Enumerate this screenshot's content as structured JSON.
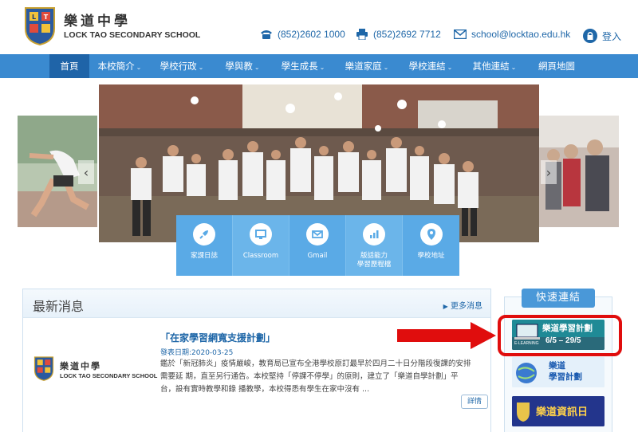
{
  "header": {
    "school_cn": "樂道中學",
    "school_en": "LOCK TAO SECONDARY SCHOOL",
    "phone": "(852)2602 1000",
    "fax": "(852)2692 7712",
    "email": "school@locktao.edu.hk",
    "login": "登入"
  },
  "nav": {
    "items": [
      "首頁",
      "本校簡介",
      "學校行政",
      "學與教",
      "學生成長",
      "樂道家庭",
      "學校連結",
      "其他連結",
      "網頁地圖"
    ]
  },
  "tiles": [
    {
      "label": "家課日誌",
      "icon": "rocket-icon"
    },
    {
      "label": "Classroom",
      "icon": "monitor-icon"
    },
    {
      "label": "Gmail",
      "icon": "mail-icon"
    },
    {
      "label": "版話能力\n學習歷程檔",
      "icon": "bar-chart-icon"
    },
    {
      "label": "學校地址",
      "icon": "map-pin-icon"
    }
  ],
  "news": {
    "title": "最新消息",
    "more": "更多消息",
    "logo_cn": "樂道中學",
    "logo_en": "LOCK TAO SECONDARY SCHOOL",
    "article_title": "「在家學習網寬支援計劃」",
    "article_date": "發表日期:2020-03-25",
    "article_body": "鑑於「新冠肺炎」疫情嚴峻，教育局已宣布全港學校原訂最早於四月二十日分階段復課的安排需要延 期，直至另行通告。本校堅持「停課不停學」的原則，建立了「樂道自學計劃」平台，設有實時教學和錄 播教學，本校得悉有學生在家中沒有 ...",
    "detail": "詳情"
  },
  "quick_links": {
    "title": "快速連結",
    "banner1_title": "樂道學習計劃",
    "banner1_tag": "E-LEARNING",
    "banner1_dates": "6/5 – 29/5",
    "banner2_title": "樂道\n學習計劃",
    "banner3_title": "樂道資訊日"
  },
  "colors": {
    "nav": "#3a8ad0",
    "nav_active": "#1f64a8",
    "link": "#1f67a8",
    "highlight": "#e00d0d"
  }
}
